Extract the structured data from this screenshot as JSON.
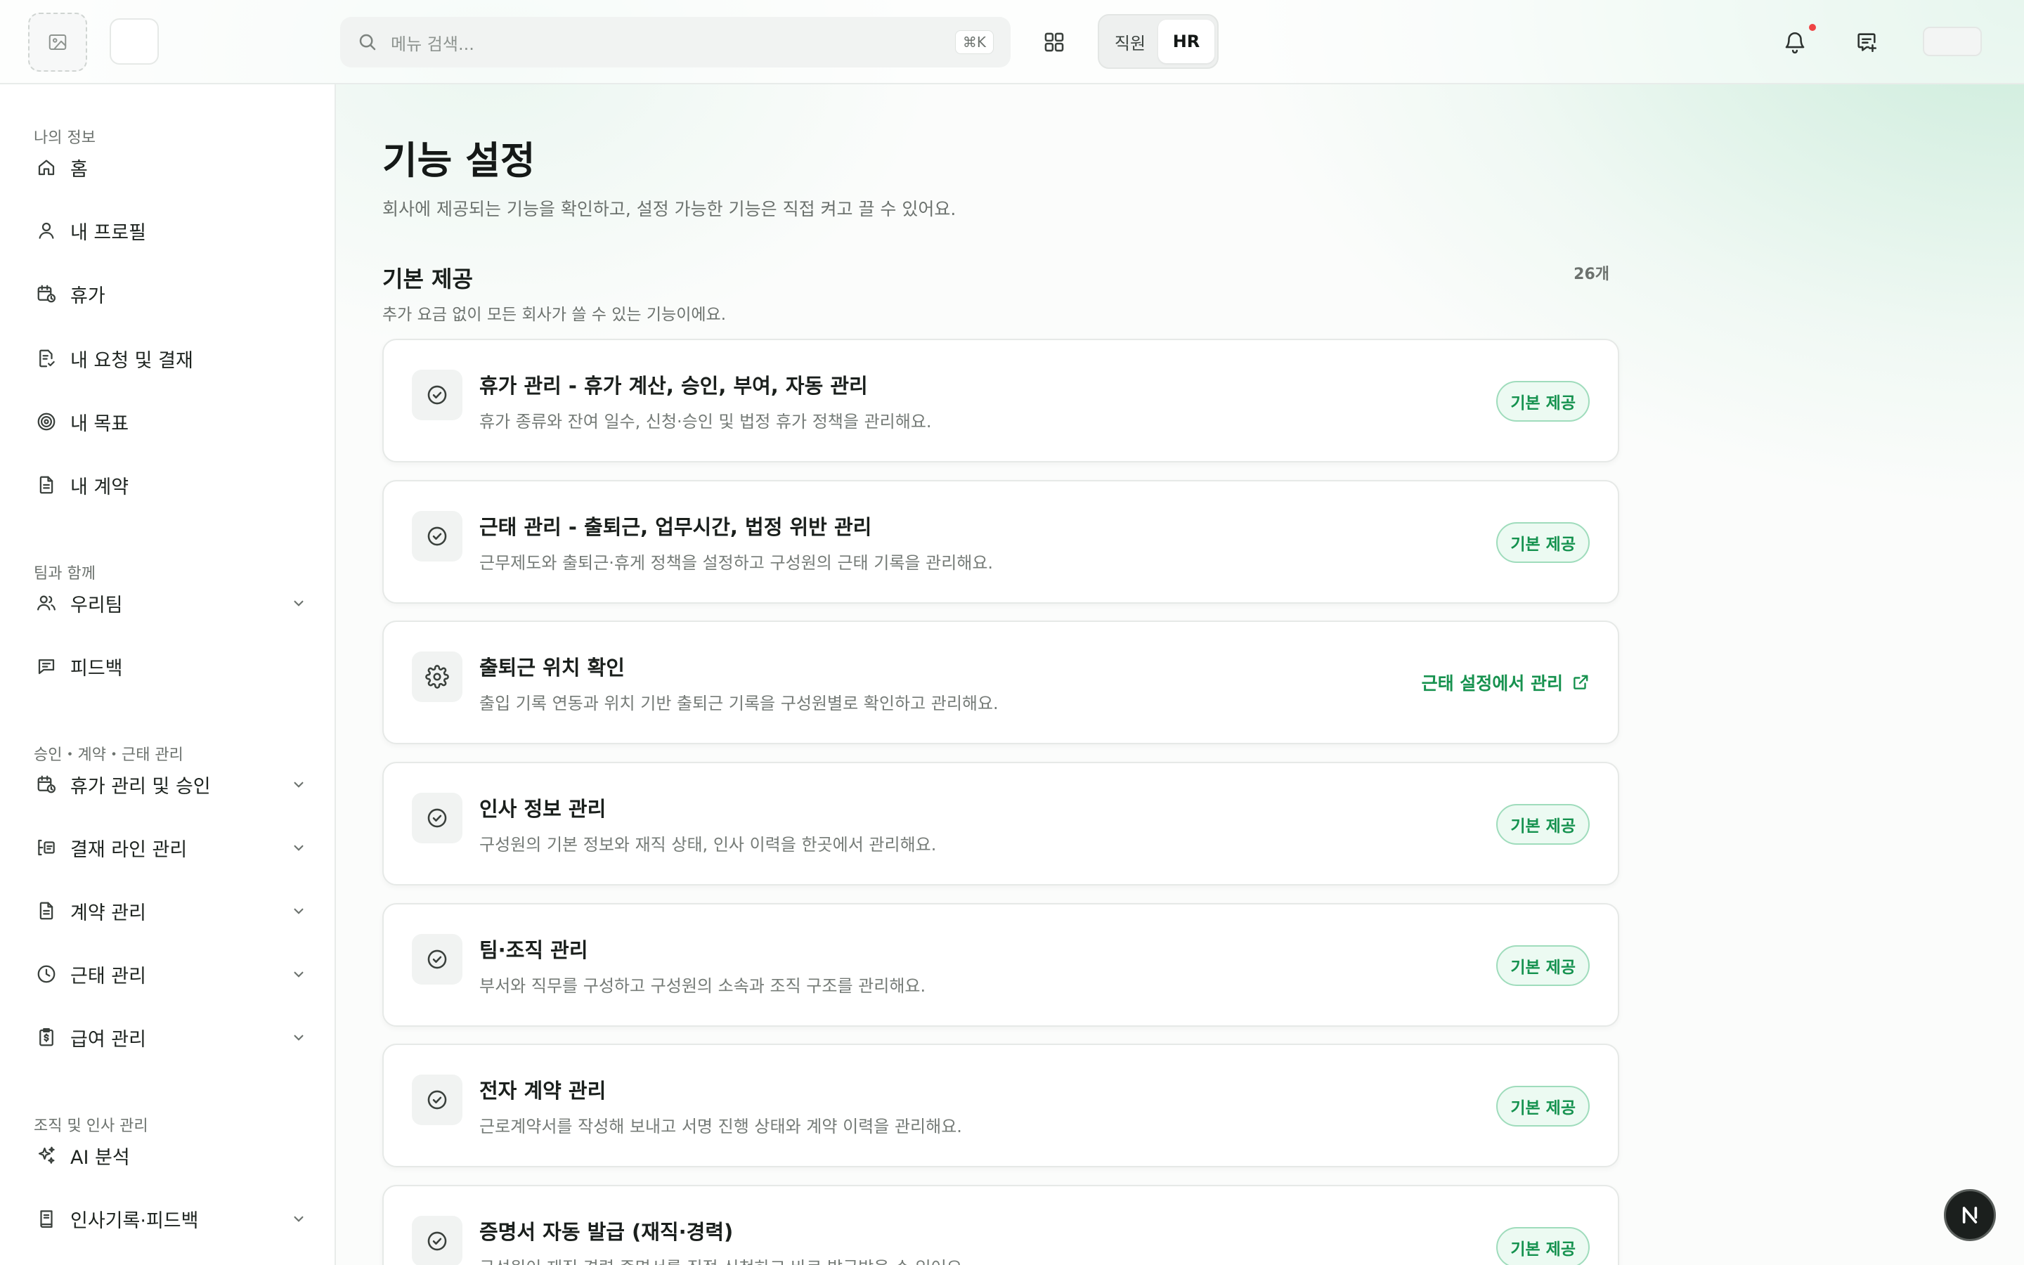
{
  "header": {
    "search_placeholder": "메뉴 검색...",
    "search_shortcut": "⌘K",
    "role_options": [
      "직원",
      "HR"
    ],
    "active_role": "HR",
    "has_notification": true
  },
  "sidebar": {
    "sections": [
      {
        "label": "나의 정보",
        "items": [
          {
            "label": "홈",
            "icon": "home-icon",
            "expandable": false
          },
          {
            "label": "내 프로필",
            "icon": "user-icon",
            "expandable": false
          },
          {
            "label": "휴가",
            "icon": "calendar-clock-icon",
            "expandable": false
          },
          {
            "label": "내 요청 및 결재",
            "icon": "document-check-icon",
            "expandable": false
          },
          {
            "label": "내 목표",
            "icon": "target-icon",
            "expandable": false
          },
          {
            "label": "내 계약",
            "icon": "file-text-icon",
            "expandable": false
          }
        ]
      },
      {
        "label": "팀과 함께",
        "items": [
          {
            "label": "우리팀",
            "icon": "users-icon",
            "expandable": true
          },
          {
            "label": "피드백",
            "icon": "message-square-icon",
            "expandable": false
          }
        ]
      },
      {
        "label": "승인・계약・근태 관리",
        "items": [
          {
            "label": "휴가 관리 및 승인",
            "icon": "calendar-clock-icon",
            "expandable": true
          },
          {
            "label": "결재 라인 관리",
            "icon": "approval-line-icon",
            "expandable": true
          },
          {
            "label": "계약 관리",
            "icon": "file-text-icon",
            "expandable": true
          },
          {
            "label": "근태 관리",
            "icon": "clock-icon",
            "expandable": true
          },
          {
            "label": "급여 관리",
            "icon": "payroll-icon",
            "expandable": true
          }
        ]
      },
      {
        "label": "조직 및 인사 관리",
        "items": [
          {
            "label": "AI 분석",
            "icon": "sparkles-icon",
            "expandable": false
          },
          {
            "label": "인사기록·피드백",
            "icon": "book-icon",
            "expandable": true
          }
        ]
      }
    ]
  },
  "main": {
    "title": "기능 설정",
    "subtitle": "회사에 제공되는 기능을 확인하고, 설정 가능한 기능은 직접 켜고 끌 수 있어요.",
    "section": {
      "title": "기본 제공",
      "count": "26개",
      "description": "추가 요금 없이 모든 회사가 쓸 수 있는 기능이에요."
    },
    "features": [
      {
        "title": "휴가 관리 - 휴가 계산, 승인, 부여, 자동 관리",
        "description": "휴가 종류와 잔여 일수, 신청·승인 및 법정 휴가 정책을 관리해요.",
        "icon": "check-circle-icon",
        "action_type": "badge",
        "action_label": "기본 제공"
      },
      {
        "title": "근태 관리 - 출퇴근, 업무시간, 법정 위반 관리",
        "description": "근무제도와 출퇴근·휴게 정책을 설정하고 구성원의 근태 기록을 관리해요.",
        "icon": "check-circle-icon",
        "action_type": "badge",
        "action_label": "기본 제공"
      },
      {
        "title": "출퇴근 위치 확인",
        "description": "출입 기록 연동과 위치 기반 출퇴근 기록을 구성원별로 확인하고 관리해요.",
        "icon": "gear-icon",
        "action_type": "link",
        "action_label": "근태 설정에서 관리"
      },
      {
        "title": "인사 정보 관리",
        "description": "구성원의 기본 정보와 재직 상태, 인사 이력을 한곳에서 관리해요.",
        "icon": "check-circle-icon",
        "action_type": "badge",
        "action_label": "기본 제공"
      },
      {
        "title": "팀·조직 관리",
        "description": "부서와 직무를 구성하고 구성원의 소속과 조직 구조를 관리해요.",
        "icon": "check-circle-icon",
        "action_type": "badge",
        "action_label": "기본 제공"
      },
      {
        "title": "전자 계약 관리",
        "description": "근로계약서를 작성해 보내고 서명 진행 상태와 계약 이력을 관리해요.",
        "icon": "check-circle-icon",
        "action_type": "badge",
        "action_label": "기본 제공"
      },
      {
        "title": "증명서 자동 발급 (재직·경력)",
        "description": "구성원이 재직·경력 증명서를 직접 신청하고 바로 발급받을 수 있어요.",
        "icon": "check-circle-icon",
        "action_type": "badge",
        "action_label": "기본 제공"
      }
    ]
  },
  "fab_label": "N",
  "colors": {
    "accent_green": "#15924f",
    "badge_bg": "#ecfaf2",
    "badge_border": "#9fdcbc",
    "notification_dot": "#ef4444"
  }
}
